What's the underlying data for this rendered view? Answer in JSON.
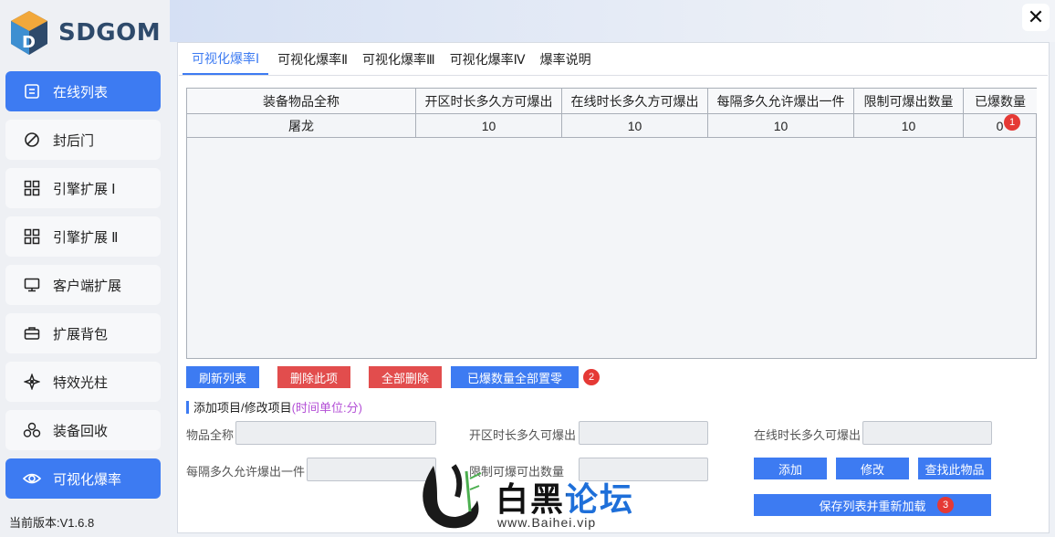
{
  "app": {
    "logo_text": "SDGOM",
    "version": "当前版本:V1.6.8",
    "close_glyph": "✕"
  },
  "sidebar": {
    "items": [
      {
        "label": "在线列表",
        "icon": "list-icon",
        "active": true
      },
      {
        "label": "封后门",
        "icon": "ban-icon",
        "active": false
      },
      {
        "label": "引擎扩展 Ⅰ",
        "icon": "grid-icon",
        "active": false
      },
      {
        "label": "引擎扩展 Ⅱ",
        "icon": "grid-icon",
        "active": false
      },
      {
        "label": "客户端扩展",
        "icon": "monitor-icon",
        "active": false
      },
      {
        "label": "扩展背包",
        "icon": "briefcase-icon",
        "active": false
      },
      {
        "label": "特效光柱",
        "icon": "sparkle-icon",
        "active": false
      },
      {
        "label": "装备回收",
        "icon": "recycle-icon",
        "active": false
      },
      {
        "label": "可视化爆率",
        "icon": "eye-icon",
        "active": true
      }
    ]
  },
  "tabs": [
    {
      "label": "可视化爆率Ⅰ",
      "active": true
    },
    {
      "label": "可视化爆率Ⅱ",
      "active": false
    },
    {
      "label": "可视化爆率Ⅲ",
      "active": false
    },
    {
      "label": "可视化爆率Ⅳ",
      "active": false
    },
    {
      "label": "爆率说明",
      "active": false
    }
  ],
  "table": {
    "columns": [
      "装备物品全称",
      "开区时长多久方可爆出",
      "在线时长多久方可爆出",
      "每隔多久允许爆出一件",
      "限制可爆出数量",
      "已爆数量"
    ],
    "rows": [
      [
        "屠龙",
        "10",
        "10",
        "10",
        "10",
        "0"
      ]
    ]
  },
  "actions": {
    "refresh": "刷新列表",
    "delete_item": "删除此项",
    "delete_all": "全部删除",
    "reset_count": "已爆数量全部置零"
  },
  "form": {
    "section_title": "添加项目/修改项目",
    "section_note": "(时间单位:分)",
    "item_name_label": "物品全称",
    "open_time_label": "开区时长多久可爆出",
    "online_time_label": "在线时长多久可爆出",
    "interval_label": "每隔多久允许爆出一件",
    "limit_label": "限制可爆可出数量",
    "item_name_value": "",
    "open_time_value": "",
    "online_time_value": "",
    "interval_value": "",
    "limit_value": "",
    "add": "添加",
    "modify": "修改",
    "find": "查找此物品",
    "save": "保存列表并重新加载"
  },
  "badges": [
    "1",
    "2",
    "3"
  ],
  "watermark": {
    "title": "白黑论坛",
    "url": "www.Baihei.vip"
  },
  "colors": {
    "accent": "#3d7bf2",
    "danger": "#e24d4d",
    "badge": "#e53935",
    "note": "#b34fd6"
  }
}
